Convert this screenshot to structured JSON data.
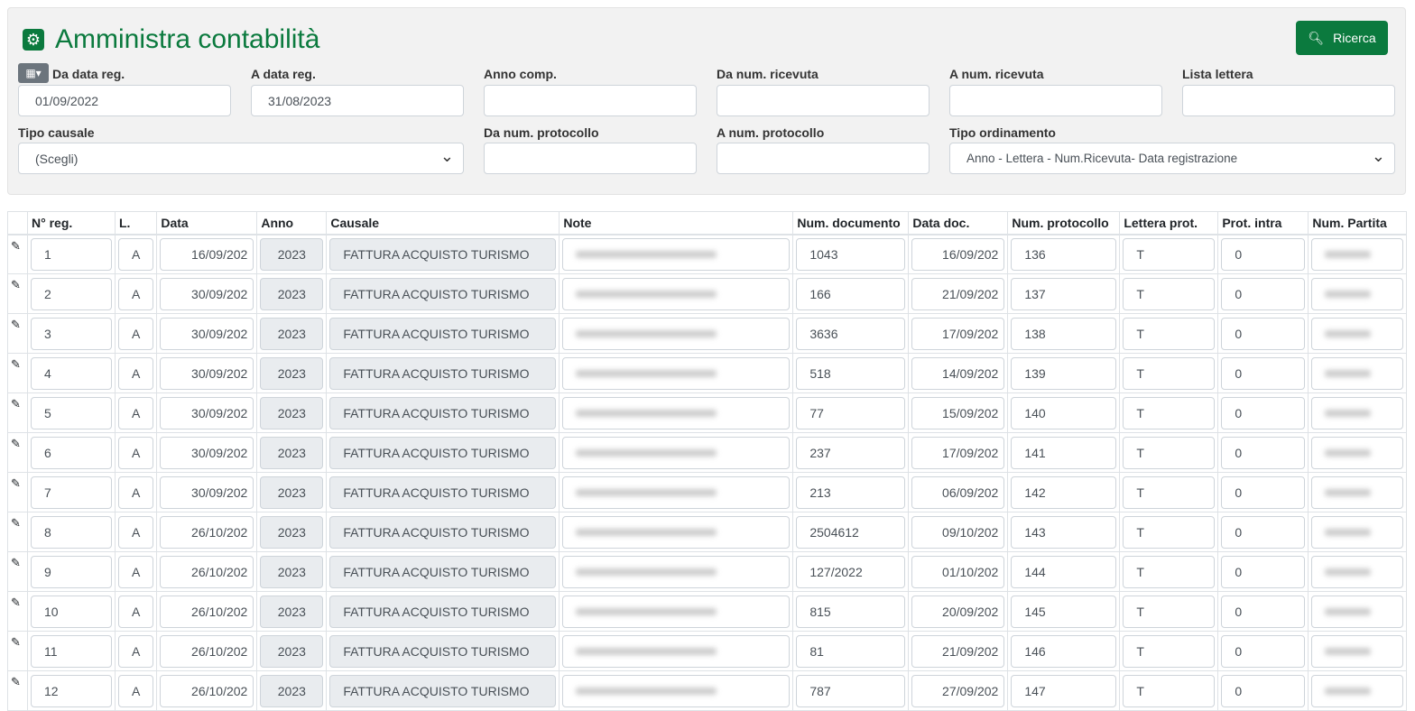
{
  "title": "Amministra contabilità",
  "search_button": "Ricerca",
  "filters": {
    "da_data_reg": {
      "label": "Da data reg.",
      "value": "01/09/2022"
    },
    "a_data_reg": {
      "label": "A data reg.",
      "value": "31/08/2023"
    },
    "anno_comp": {
      "label": "Anno comp.",
      "value": ""
    },
    "da_num_ricevuta": {
      "label": "Da num. ricevuta",
      "value": ""
    },
    "a_num_ricevuta": {
      "label": "A num. ricevuta",
      "value": ""
    },
    "lista_lettera": {
      "label": "Lista lettera",
      "value": ""
    },
    "tipo_causale": {
      "label": "Tipo causale",
      "value": "(Scegli)"
    },
    "da_num_protocollo": {
      "label": "Da num. protocollo",
      "value": ""
    },
    "a_num_protocollo": {
      "label": "A num. protocollo",
      "value": ""
    },
    "tipo_ordinamento": {
      "label": "Tipo ordinamento",
      "value": "Anno - Lettera - Num.Ricevuta- Data registrazione"
    }
  },
  "columns": [
    "N° reg.",
    "L.",
    "Data",
    "Anno",
    "Causale",
    "Note",
    "Num. documento",
    "Data doc.",
    "Num. protocollo",
    "Lettera prot.",
    "Prot. intra",
    "Num. Partita"
  ],
  "rows": [
    {
      "n": "1",
      "l": "A",
      "data": "16/09/202",
      "anno": "2023",
      "causale": "FATTURA ACQUISTO TURISMO",
      "numdoc": "1043",
      "datadoc": "16/09/202",
      "prot": "136",
      "lett": "T",
      "intra": "0"
    },
    {
      "n": "2",
      "l": "A",
      "data": "30/09/202",
      "anno": "2023",
      "causale": "FATTURA ACQUISTO TURISMO",
      "numdoc": "166",
      "datadoc": "21/09/202",
      "prot": "137",
      "lett": "T",
      "intra": "0"
    },
    {
      "n": "3",
      "l": "A",
      "data": "30/09/202",
      "anno": "2023",
      "causale": "FATTURA ACQUISTO TURISMO",
      "numdoc": "3636",
      "datadoc": "17/09/202",
      "prot": "138",
      "lett": "T",
      "intra": "0"
    },
    {
      "n": "4",
      "l": "A",
      "data": "30/09/202",
      "anno": "2023",
      "causale": "FATTURA ACQUISTO TURISMO",
      "numdoc": "518",
      "datadoc": "14/09/202",
      "prot": "139",
      "lett": "T",
      "intra": "0"
    },
    {
      "n": "5",
      "l": "A",
      "data": "30/09/202",
      "anno": "2023",
      "causale": "FATTURA ACQUISTO TURISMO",
      "numdoc": "77",
      "datadoc": "15/09/202",
      "prot": "140",
      "lett": "T",
      "intra": "0"
    },
    {
      "n": "6",
      "l": "A",
      "data": "30/09/202",
      "anno": "2023",
      "causale": "FATTURA ACQUISTO TURISMO",
      "numdoc": "237",
      "datadoc": "17/09/202",
      "prot": "141",
      "lett": "T",
      "intra": "0"
    },
    {
      "n": "7",
      "l": "A",
      "data": "30/09/202",
      "anno": "2023",
      "causale": "FATTURA ACQUISTO TURISMO",
      "numdoc": "213",
      "datadoc": "06/09/202",
      "prot": "142",
      "lett": "T",
      "intra": "0"
    },
    {
      "n": "8",
      "l": "A",
      "data": "26/10/202",
      "anno": "2023",
      "causale": "FATTURA ACQUISTO TURISMO",
      "numdoc": "2504612",
      "datadoc": "09/10/202",
      "prot": "143",
      "lett": "T",
      "intra": "0"
    },
    {
      "n": "9",
      "l": "A",
      "data": "26/10/202",
      "anno": "2023",
      "causale": "FATTURA ACQUISTO TURISMO",
      "numdoc": "127/2022",
      "datadoc": "01/10/202",
      "prot": "144",
      "lett": "T",
      "intra": "0"
    },
    {
      "n": "10",
      "l": "A",
      "data": "26/10/202",
      "anno": "2023",
      "causale": "FATTURA ACQUISTO TURISMO",
      "numdoc": "815",
      "datadoc": "20/09/202",
      "prot": "145",
      "lett": "T",
      "intra": "0"
    },
    {
      "n": "11",
      "l": "A",
      "data": "26/10/202",
      "anno": "2023",
      "causale": "FATTURA ACQUISTO TURISMO",
      "numdoc": "81",
      "datadoc": "21/09/202",
      "prot": "146",
      "lett": "T",
      "intra": "0"
    },
    {
      "n": "12",
      "l": "A",
      "data": "26/10/202",
      "anno": "2023",
      "causale": "FATTURA ACQUISTO TURISMO",
      "numdoc": "787",
      "datadoc": "27/09/202",
      "prot": "147",
      "lett": "T",
      "intra": "0"
    }
  ]
}
